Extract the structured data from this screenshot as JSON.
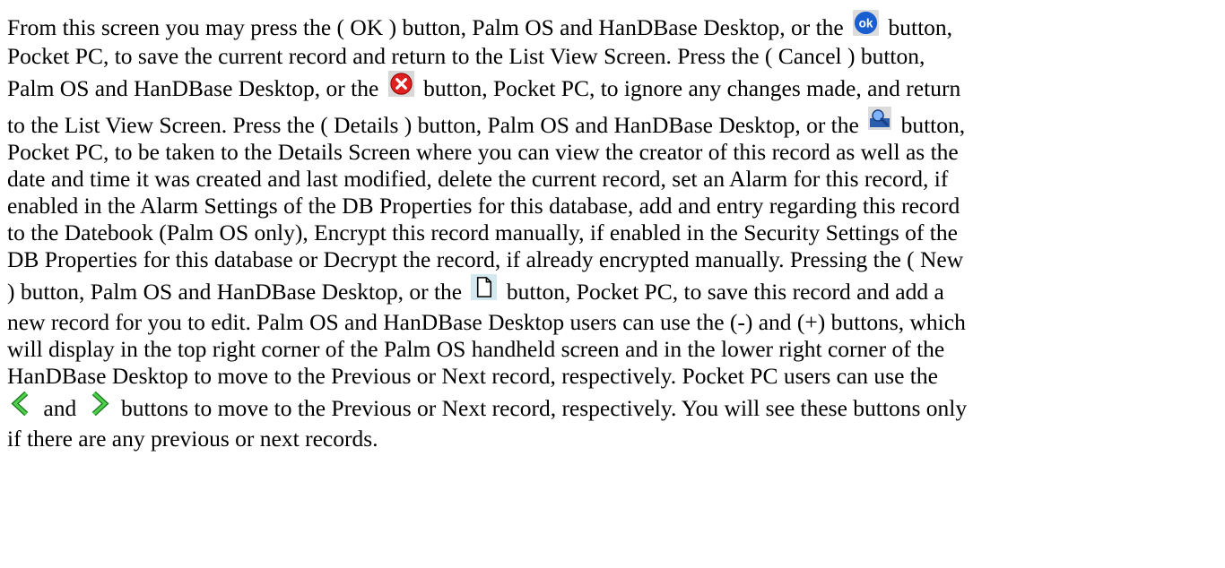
{
  "paragraph": {
    "l1a": "From this screen you may press the ( OK ) button, Palm OS and HanDBase Desktop, or the",
    "l1b": "button,",
    "l2": "Pocket PC, to save the current record and return to the List View Screen. Press the ( Cancel ) button,",
    "l3a": "Palm OS and HanDBase Desktop, or the",
    "l3b": "button, Pocket PC, to ignore any changes made, and return",
    "l4a": "to the List View Screen. Press the ( Details ) button, Palm OS and HanDBase Desktop, or the",
    "l4b": "button,",
    "l5": "Pocket PC, to be taken to the Details Screen where you can view the creator of this record as well as the",
    "l6": "date and time it was created and last modified, delete the current record, set an Alarm for this record, if",
    "l7": "enabled in the Alarm Settings of the DB Properties for this database, add and entry regarding this record",
    "l8": "to the Datebook (Palm OS only), Encrypt this record manually, if enabled in the Security Settings of the",
    "l9": "DB Properties for this database or Decrypt the record, if already encrypted manually. Pressing the ( New",
    "l10a": ") button, Palm OS and HanDBase Desktop, or the",
    "l10b": "button, Pocket PC, to save this record and add a",
    "l11": "new record for you to edit. Palm OS and HanDBase Desktop users can use the (-) and (+) buttons, which",
    "l12": "will display in the top right corner of the Palm OS handheld screen and in the lower right corner of the",
    "l13": "HanDBase Desktop to move to the Previous or Next record, respectively.  Pocket PC users can use the",
    "l14a": "and",
    "l14b": "buttons to move to the Previous or Next record, respectively.  You will see these buttons only",
    "l15": "if there are any previous or next records."
  },
  "icons": {
    "ok": "ok-icon",
    "cancel": "cancel-icon",
    "details": "details-icon",
    "new": "new-record-icon",
    "previous": "previous-arrow-icon",
    "next": "next-arrow-icon"
  },
  "colors": {
    "ok_blue": "#1a5fd0",
    "cancel_red": "#e02020",
    "arrow_green": "#2ea82e",
    "text": "#000000"
  }
}
